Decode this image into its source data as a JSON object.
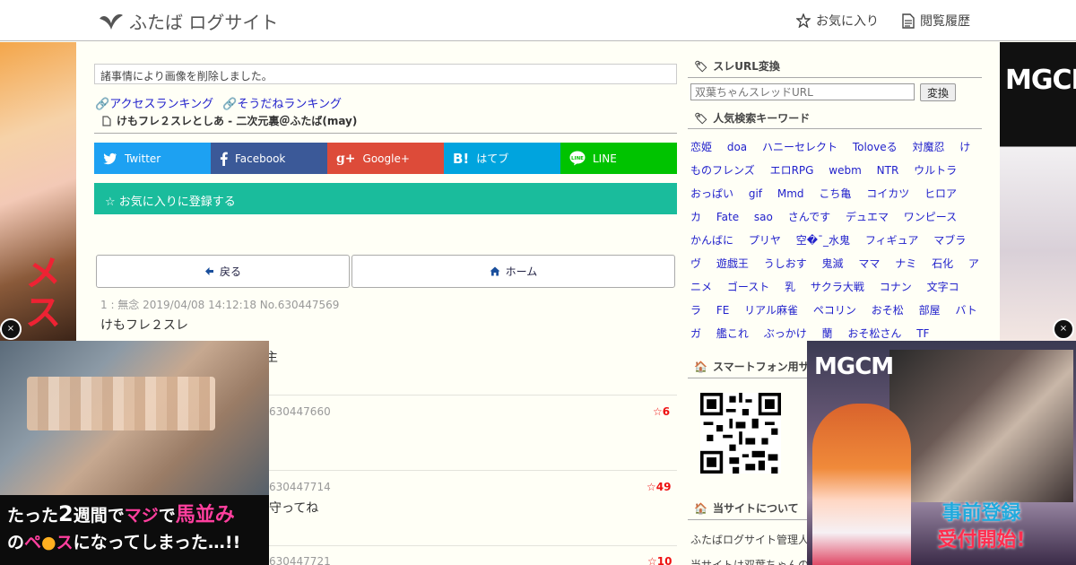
{
  "header": {
    "logo_text": "ふたば ログサイト",
    "favorites_label": "お気に入り",
    "history_label": "閲覧履歴"
  },
  "left_ad": {
    "text": "メス",
    "close": "×"
  },
  "right_ad": {
    "logo": "MGCM",
    "close": "×"
  },
  "main": {
    "notice": "諸事情により画像を削除しました。",
    "access_ranking": "アクセスランキング",
    "soudane_ranking": "そうだねランキング",
    "thread_title": "けもフレ２スレとしあ - 二次元裏＠ふたば(may)",
    "share": [
      {
        "label": "Twitter",
        "color": "#1da1f2",
        "icon": "twitter-icon"
      },
      {
        "label": "Facebook",
        "color": "#3b5998",
        "icon": "facebook-icon"
      },
      {
        "label": "Google+",
        "color": "#dd4b39",
        "icon": "google-plus-icon"
      },
      {
        "label": "はてブ",
        "color": "#00a4de",
        "icon": "hatena-icon"
      },
      {
        "label": "LINE",
        "color": "#00c300",
        "icon": "line-icon"
      }
    ],
    "favorite_register": "☆ お気に入りに登録する",
    "back_label": "戻る",
    "home_label": "ホーム",
    "posts": [
      {
        "meta": "1 : 無念 2019/04/08 14:12:18 No.630447569",
        "body": "けもフレ２スレ",
        "stars": ""
      },
      {
        "meta": "",
        "body": "主",
        "stars": ""
      },
      {
        "meta": "630447660",
        "body": "",
        "stars": "☆6"
      },
      {
        "meta": "630447714",
        "body": "守ってね",
        "stars": "☆49"
      },
      {
        "meta": "630447721",
        "body": "",
        "stars": "☆10"
      }
    ]
  },
  "sidebar": {
    "url_convert_title": "スレURL変換",
    "url_placeholder": "双葉ちゃんスレッドURL",
    "convert_button": "変換",
    "keywords_title": "人気検索キーワード",
    "keywords": [
      "恋姫",
      "doa",
      "ハニーセレクト",
      "Toloveる",
      "対魔忍",
      "けものフレンズ",
      "エロRPG",
      "webm",
      "NTR",
      "ウルトラ",
      "おっぱい",
      "gif",
      "Mmd",
      "こち亀",
      "コイカツ",
      "ヒロアカ",
      "Fate",
      "sao",
      "さんです",
      "デュエマ",
      "ワンピース",
      "かんばに",
      "プリヤ",
      "空�¯_水鬼",
      "フィギュア",
      "マブラヴ",
      "遊戯王",
      "うしおす",
      "鬼滅",
      "ママ",
      "ナミ",
      "石化",
      "アニメ",
      "ゴースト",
      "乳",
      "サクラ大戦",
      "コナン",
      "文字コラ",
      "FE",
      "リアル麻雀",
      "ペコリン",
      "おそ松",
      "部屋",
      "バトガ",
      "艦これ",
      "ぶっかけ",
      "蘭",
      "おそ松さん",
      "TF"
    ],
    "smartphone_title": "スマートフォン用サ",
    "about_title": "当サイトについて",
    "about_line1": "ふたばログサイト管理人",
    "about_line2": "当サイトは双葉ちゃんの"
  },
  "ad_bottom_left": {
    "caption_line1_a": "たった",
    "caption_line1_b": "2",
    "caption_line1_c": "週間で",
    "caption_line1_d": "マジ",
    "caption_line1_e": "で",
    "caption_line1_f": "馬並み",
    "caption_line2_a": "の",
    "caption_line2_b": "ペ",
    "caption_line2_c": "●",
    "caption_line2_d": "ス",
    "caption_line2_e": "になってしまった…!!"
  },
  "ad_bottom_right": {
    "logo": "MGCM",
    "banner_line1": "事前登録",
    "banner_line2": "受付開始!"
  }
}
